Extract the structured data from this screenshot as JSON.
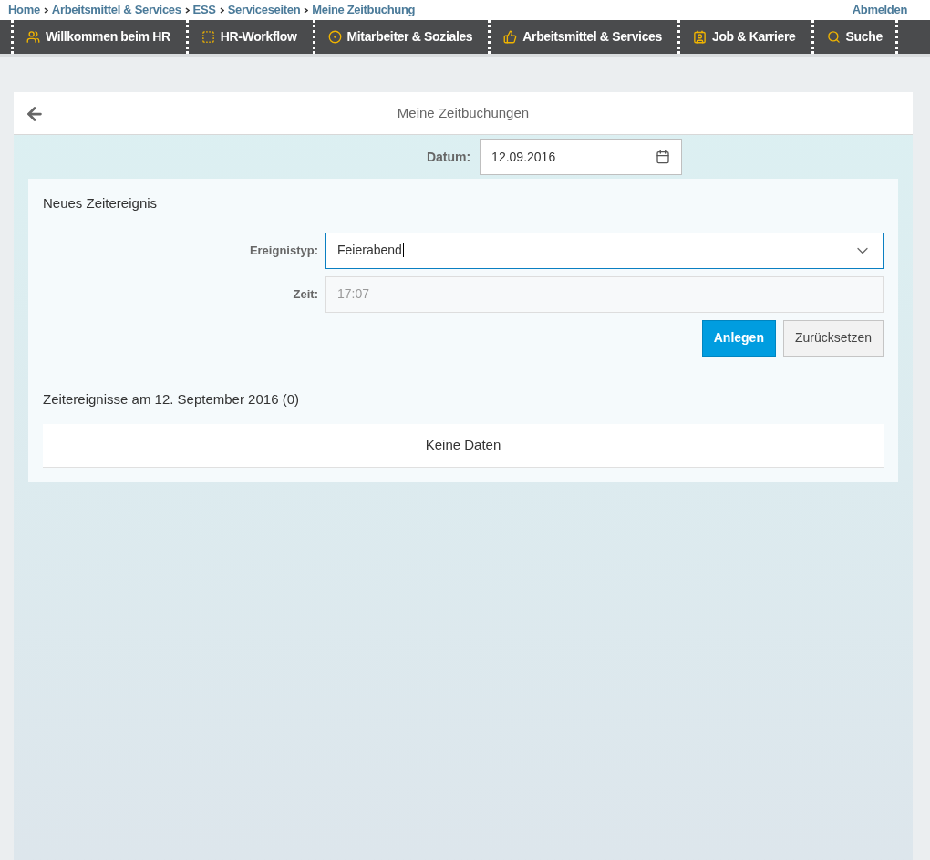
{
  "breadcrumb": [
    "Home",
    "Arbeitsmittel & Services",
    "ESS",
    "Serviceseiten",
    "Meine Zeitbuchung"
  ],
  "logout": "Abmelden",
  "nav": [
    {
      "label": "Willkommen beim HR"
    },
    {
      "label": "HR-Workflow"
    },
    {
      "label": "Mitarbeiter & Soziales"
    },
    {
      "label": "Arbeitsmittel & Services"
    },
    {
      "label": "Job & Karriere"
    },
    {
      "label": "Suche"
    }
  ],
  "page": {
    "title": "Meine Zeitbuchungen",
    "date_label": "Datum:",
    "date_value": "12.09.2016"
  },
  "form": {
    "title": "Neues Zeitereignis",
    "fields": [
      {
        "label": "Ereignistyp:",
        "value": "Feierabend",
        "kind": "select",
        "focused": true,
        "disabled": false
      },
      {
        "label": "Zeit:",
        "value": "17:07",
        "kind": "text",
        "focused": false,
        "disabled": true
      }
    ],
    "buttons": [
      {
        "label": "Anlegen",
        "primary": true
      },
      {
        "label": "Zurücksetzen",
        "primary": false
      }
    ]
  },
  "events": {
    "title": "Zeitereignisse am 12. September 2016 (0)",
    "empty": "Keine Daten"
  }
}
